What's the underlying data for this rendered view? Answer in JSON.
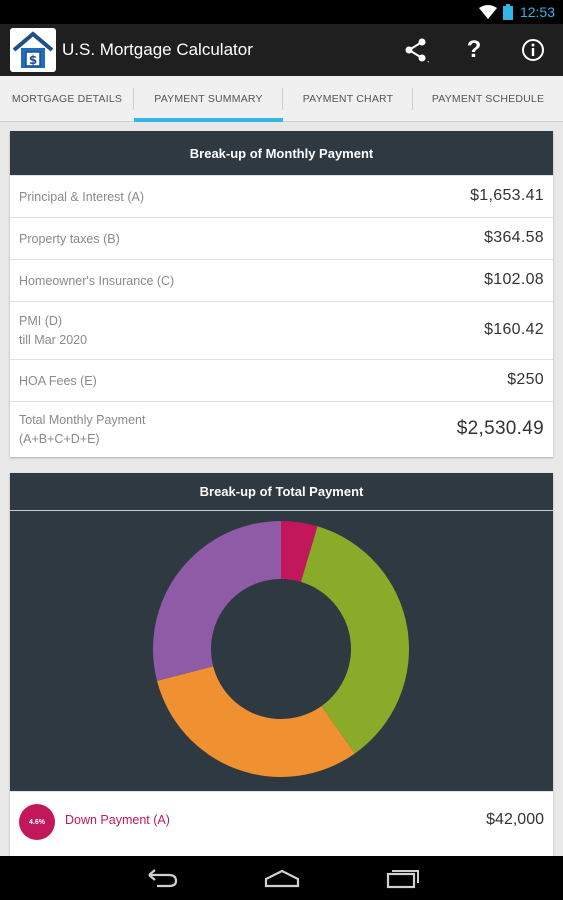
{
  "status_bar": {
    "time": "12:53"
  },
  "app": {
    "title": "U.S. Mortgage Calculator"
  },
  "tabs": [
    {
      "label": "MORTGAGE DETAILS",
      "active": false
    },
    {
      "label": "PAYMENT SUMMARY",
      "active": true
    },
    {
      "label": "PAYMENT CHART",
      "active": false
    },
    {
      "label": "PAYMENT SCHEDULE",
      "active": false
    }
  ],
  "monthly": {
    "title": "Break-up of Monthly Payment",
    "rows": [
      {
        "label": "Principal & Interest (A)",
        "value": "$1,653.41"
      },
      {
        "label": "Property taxes (B)",
        "value": "$364.58"
      },
      {
        "label": "Homeowner's Insurance (C)",
        "value": "$102.08"
      },
      {
        "label": "PMI (D)",
        "sublabel": "till Mar 2020",
        "value": "$160.42"
      },
      {
        "label": "HOA Fees (E)",
        "value": "$250"
      },
      {
        "label": "Total Monthly Payment",
        "sublabel": "(A+B+C+D+E)",
        "value": "$2,530.49"
      }
    ]
  },
  "total": {
    "title": "Break-up of Total Payment",
    "legend": [
      {
        "label": "Down Payment (A)",
        "percent": "4.6%",
        "value": "$42,000",
        "color": "#c2185b"
      }
    ]
  },
  "chart_data": {
    "type": "pie",
    "title": "Break-up of Total Payment",
    "slices": [
      {
        "value": 4.6,
        "color": "#c2185b"
      },
      {
        "value": 35.6,
        "color": "#8aaa2a"
      },
      {
        "value": 30.8,
        "color": "#ef9031"
      },
      {
        "value": 29.0,
        "color": "#8f5aa6"
      }
    ]
  },
  "colors": {
    "accent": "#33b5e5",
    "header_bg": "#2f3942",
    "action_bar": "#1f1f1f"
  }
}
